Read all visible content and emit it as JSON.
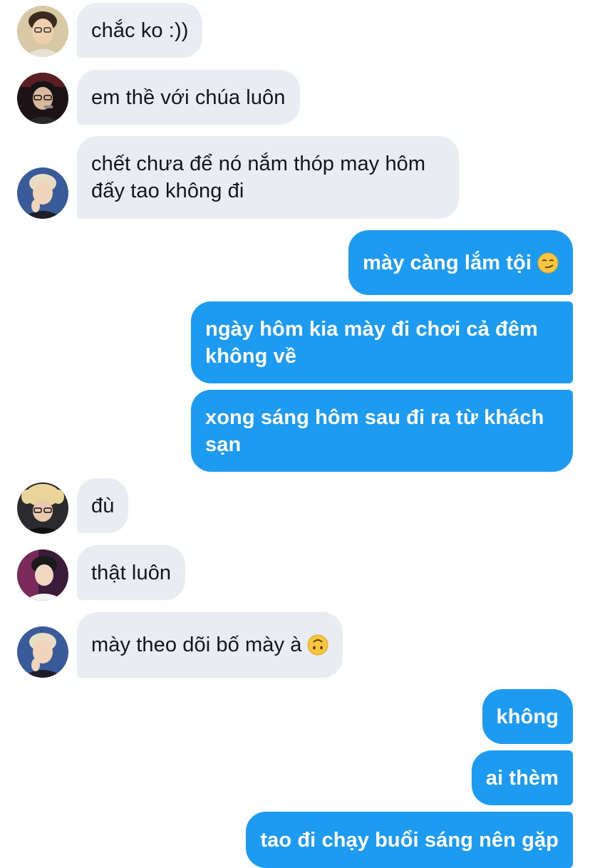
{
  "messages": [
    {
      "side": "in",
      "text": "chắc ko :))",
      "avatar": "avatar-user-1"
    },
    {
      "side": "in",
      "text": "em thề với chúa luôn",
      "avatar": "avatar-user-2"
    },
    {
      "side": "in",
      "text": "chết chưa để nó nắm thóp may hôm đấy tao không đi",
      "avatar": "avatar-user-3"
    },
    {
      "side": "out",
      "text": "mày càng lắm tội",
      "emoji": "smirk-face-icon"
    },
    {
      "side": "out",
      "text": "ngày hôm kia mày đi chơi cả đêm không về"
    },
    {
      "side": "out",
      "text": "xong sáng hôm sau đi ra từ khách sạn"
    },
    {
      "side": "in",
      "text": "đù",
      "avatar": "avatar-user-4"
    },
    {
      "side": "in",
      "text": "thật luôn",
      "avatar": "avatar-user-5"
    },
    {
      "side": "in",
      "text": "mày theo dõi bố mày à",
      "avatar": "avatar-user-3",
      "emoji": "upside-down-face-icon"
    },
    {
      "side": "out",
      "text": "không"
    },
    {
      "side": "out",
      "text": "ai thèm"
    },
    {
      "side": "out",
      "text": "tao đi chạy buổi sáng nên gặp"
    }
  ],
  "colors": {
    "incoming_bubble": "#e9edf1",
    "outgoing_bubble": "#1d9bf0",
    "incoming_text": "#14171a",
    "outgoing_text": "#ffffff"
  }
}
